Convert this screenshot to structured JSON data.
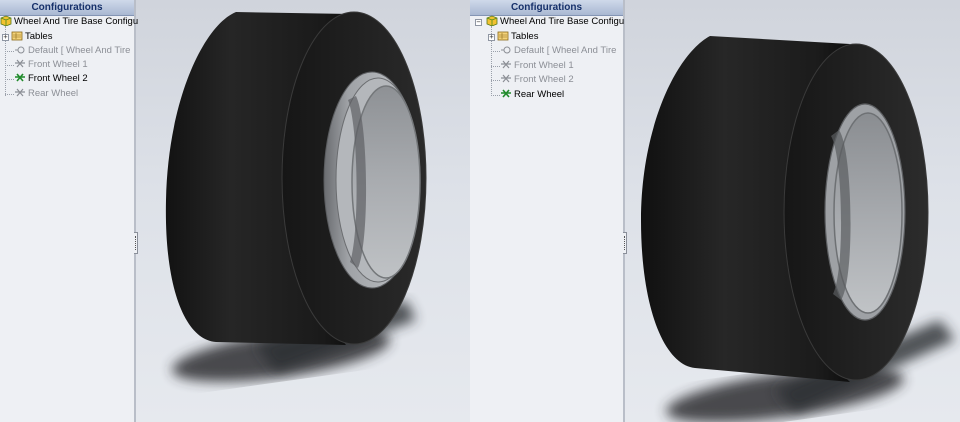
{
  "panels": [
    {
      "header": "Configurations",
      "root": "Wheel And Tire Base Configu",
      "items": [
        {
          "label": "Tables",
          "icon": "tables-folder-icon",
          "active": true
        },
        {
          "label": "Default [ Wheel And Tire",
          "icon": "config-icon",
          "active": false
        },
        {
          "label": "Front Wheel 1",
          "icon": "config-icon",
          "active": false
        },
        {
          "label": "Front Wheel 2",
          "icon": "active-config-icon",
          "active": true
        },
        {
          "label": "Rear Wheel",
          "icon": "config-icon",
          "active": false
        }
      ]
    },
    {
      "header": "Configurations",
      "root": "Wheel And Tire Base Configu",
      "items": [
        {
          "label": "Tables",
          "icon": "tables-folder-icon",
          "active": true
        },
        {
          "label": "Default [ Wheel And Tire",
          "icon": "config-icon",
          "active": false
        },
        {
          "label": "Front Wheel 1",
          "icon": "config-icon",
          "active": false
        },
        {
          "label": "Front Wheel 2",
          "icon": "config-icon",
          "active": false
        },
        {
          "label": "Rear Wheel",
          "icon": "active-config-icon",
          "active": true
        }
      ]
    }
  ],
  "colors": {
    "tire": "#1c1c1c",
    "rim": "#a7aaae",
    "header_text": "#16306a"
  }
}
